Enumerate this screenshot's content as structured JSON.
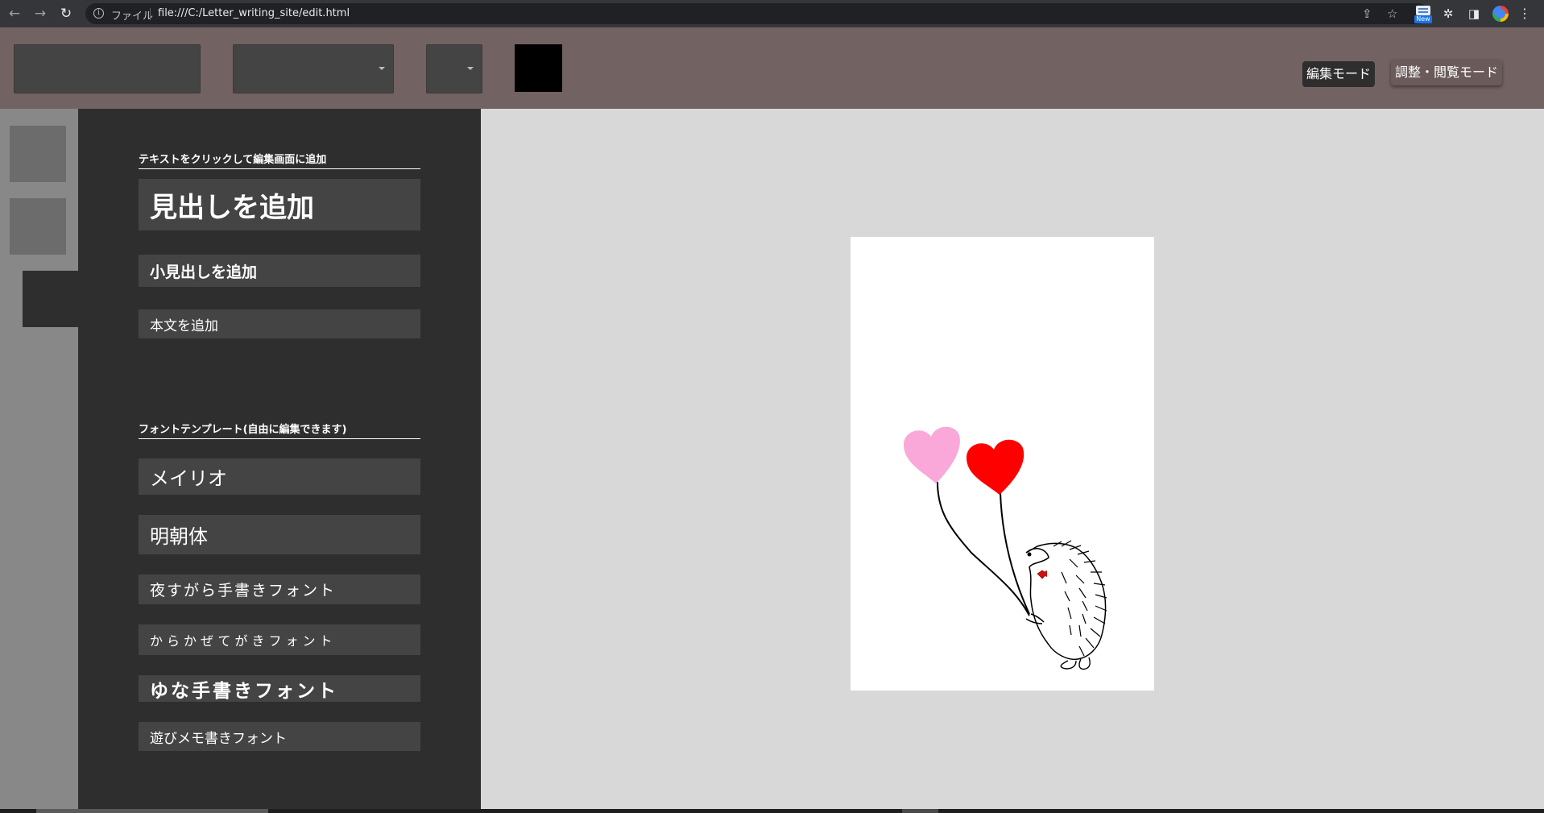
{
  "browser": {
    "back_icon": "arrow-left-icon",
    "forward_icon": "arrow-right-icon",
    "reload_icon": "reload-icon",
    "info_icon": "info-icon",
    "scheme_label": "ファイル",
    "url": "file:///C:/Letter_writing_site/edit.html",
    "share_icon": "share-icon",
    "bookmark_icon": "star-icon",
    "extension_new_badge": "New",
    "extensions_icon": "puzzle-icon",
    "side_panel_icon": "side-panel-icon",
    "profile_icon": "profile-avatar-icon",
    "menu_icon": "kebab-menu-icon"
  },
  "toolbar": {
    "font_select_value": "",
    "size_select_value": "",
    "align_select_value": "",
    "text_color": "#000000",
    "edit_mode_label": "編集モード",
    "view_mode_label": "調整・閲覧モード"
  },
  "panel": {
    "text_section_title": "テキストをクリックして編集画面に追加",
    "add_heading": "見出しを追加",
    "add_subheading": "小見出しを追加",
    "add_body": "本文を追加",
    "font_section_title": "フォントテンプレート(自由に編集できます)",
    "fonts": [
      "メイリオ",
      "明朝体",
      "夜すがら手書きフォント",
      "からかぜてがきフォント",
      "ゆな手書きフォント",
      "遊びメモ書きフォント"
    ]
  },
  "letter": {
    "illustration": "hedgehog-with-heart-balloons",
    "balloon_colors": [
      "#f8a8d8",
      "#ff0000"
    ],
    "bowtie_color": "#d01010"
  }
}
